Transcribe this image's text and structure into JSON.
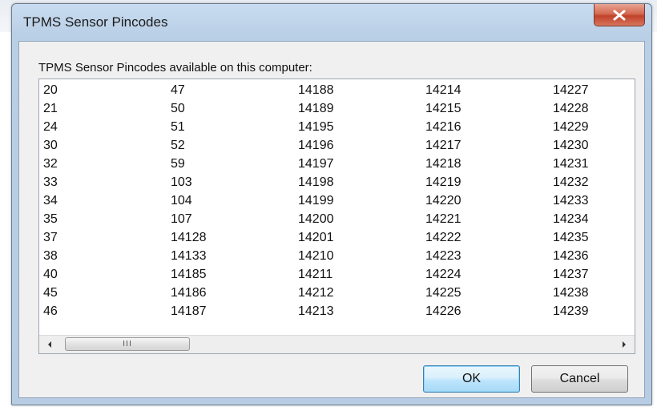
{
  "window": {
    "title": "TPMS Sensor Pincodes"
  },
  "dialog": {
    "prompt": "TPMS Sensor Pincodes available on this computer:"
  },
  "pincodes": {
    "columns": [
      [
        "20",
        "21",
        "24",
        "30",
        "32",
        "33",
        "34",
        "35",
        "37",
        "38",
        "40",
        "45",
        "46"
      ],
      [
        "47",
        "50",
        "51",
        "52",
        "59",
        "103",
        "104",
        "107",
        "14128",
        "14133",
        "14185",
        "14186",
        "14187"
      ],
      [
        "14188",
        "14189",
        "14195",
        "14196",
        "14197",
        "14198",
        "14199",
        "14200",
        "14201",
        "14210",
        "14211",
        "14212",
        "14213"
      ],
      [
        "14214",
        "14215",
        "14216",
        "14217",
        "14218",
        "14219",
        "14220",
        "14221",
        "14222",
        "14223",
        "14224",
        "14225",
        "14226"
      ],
      [
        "14227",
        "14228",
        "14229",
        "14230",
        "14231",
        "14232",
        "14233",
        "14234",
        "14235",
        "14236",
        "14237",
        "14238",
        "14239"
      ]
    ]
  },
  "scrollbar": {
    "grip": "III"
  },
  "buttons": {
    "ok": "OK",
    "cancel": "Cancel"
  },
  "icons": {
    "close": "close-icon",
    "scroll_left": "arrow-left-icon",
    "scroll_right": "arrow-right-icon"
  }
}
